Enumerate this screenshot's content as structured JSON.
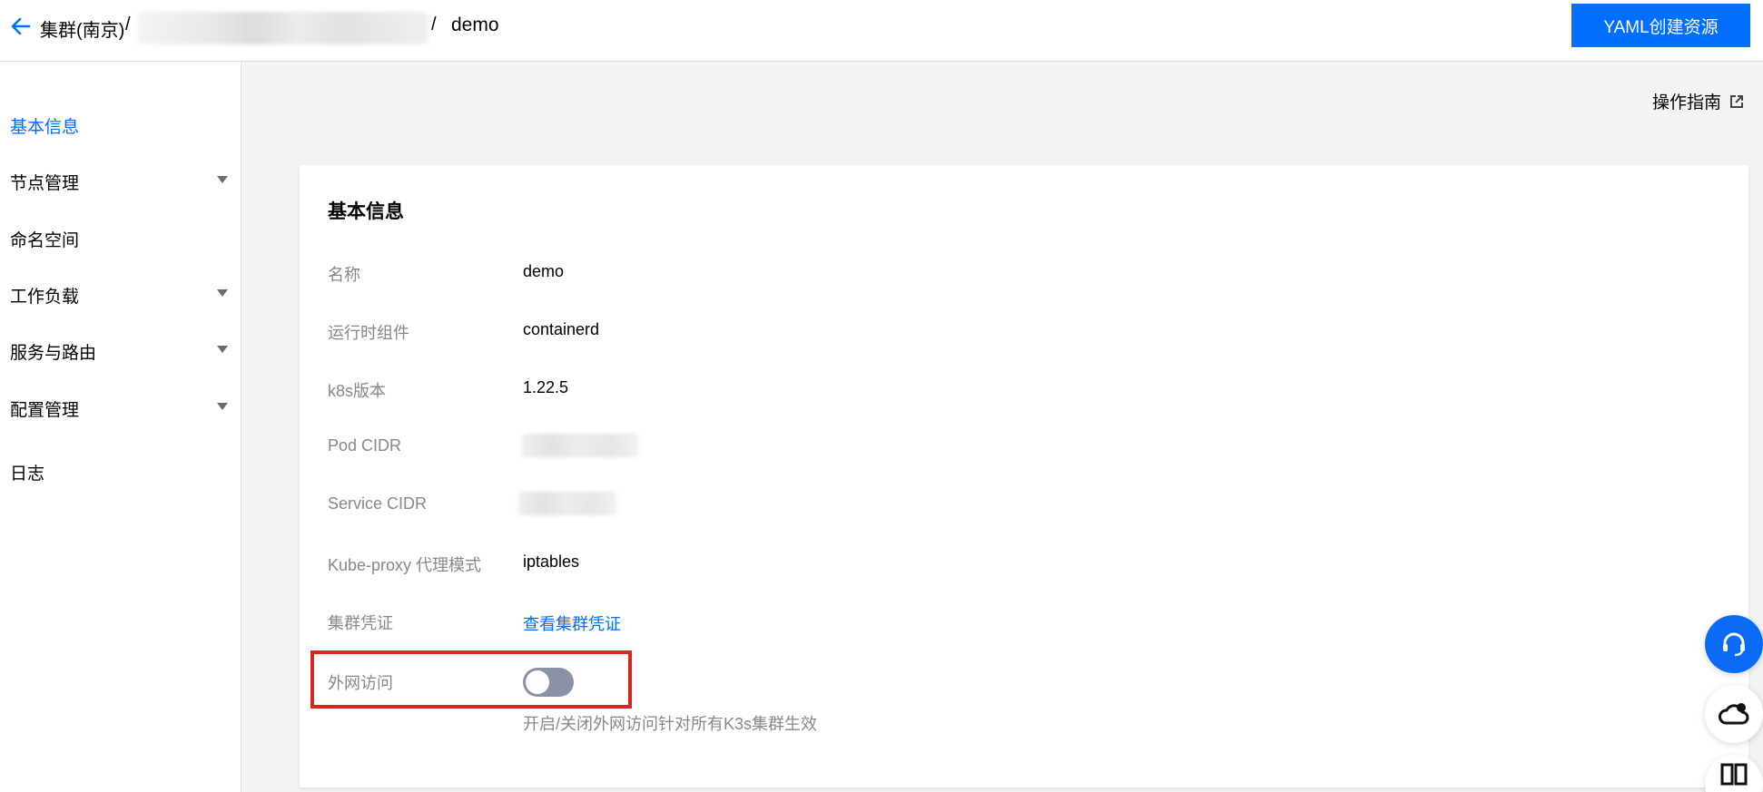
{
  "header": {
    "breadcrumb_cluster": "集群(南京)",
    "separator": "/",
    "current": "demo",
    "yaml_button": "YAML创建资源"
  },
  "sidebar": {
    "items": [
      {
        "label": "基本信息",
        "active": true,
        "expandable": false
      },
      {
        "label": "节点管理",
        "active": false,
        "expandable": true
      },
      {
        "label": "命名空间",
        "active": false,
        "expandable": false
      },
      {
        "label": "工作负载",
        "active": false,
        "expandable": true
      },
      {
        "label": "服务与路由",
        "active": false,
        "expandable": true
      },
      {
        "label": "配置管理",
        "active": false,
        "expandable": true
      },
      {
        "label": "日志",
        "active": false,
        "expandable": false
      }
    ]
  },
  "guide_link": "操作指南",
  "card": {
    "title": "基本信息",
    "rows": [
      {
        "label": "名称",
        "value": "demo"
      },
      {
        "label": "运行时组件",
        "value": "containerd"
      },
      {
        "label": "k8s版本",
        "value": "1.22.5"
      },
      {
        "label": "Pod CIDR",
        "value": ""
      },
      {
        "label": "Service CIDR",
        "value": ""
      },
      {
        "label": "Kube-proxy 代理模式",
        "value": "iptables"
      },
      {
        "label": "集群凭证",
        "value": "查看集群凭证"
      },
      {
        "label": "外网访问",
        "value": ""
      }
    ],
    "public_access_enabled": false,
    "public_access_hint": "开启/关闭外网访问针对所有K3s集群生效"
  },
  "colors": {
    "accent": "#006eff",
    "highlight_border": "#d9261c",
    "toggle_off": "#8a93a6"
  },
  "icons": [
    "back-arrow-icon",
    "external-link-icon",
    "headset-icon",
    "cloud-bell-icon",
    "book-icon",
    "chevron-down-icon"
  ]
}
